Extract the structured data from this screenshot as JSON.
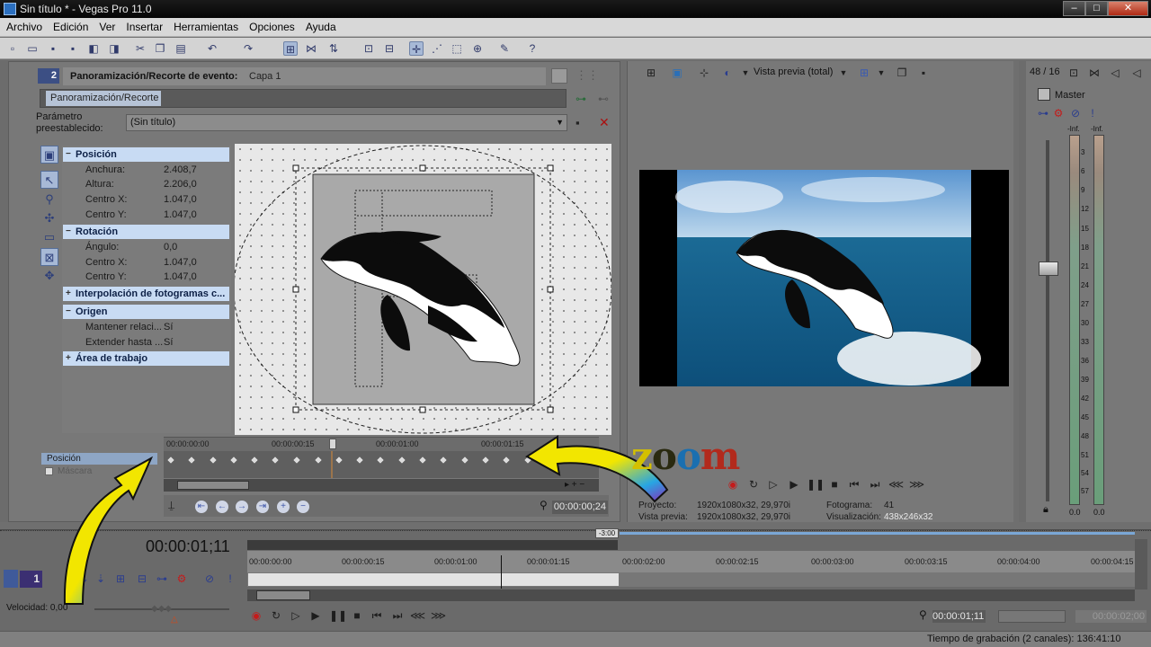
{
  "window": {
    "title": "Sin título * - Vegas Pro 11.0",
    "minimize": "–",
    "maximize": "□",
    "close": "✕"
  },
  "menu": [
    "Archivo",
    "Edición",
    "Ver",
    "Insertar",
    "Herramientas",
    "Opciones",
    "Ayuda"
  ],
  "pan_panel": {
    "chip": "2",
    "title": "Panoramización/Recorte de evento:",
    "subtitle": "Capa 1",
    "fx_tag": "Panoramización/Recorte",
    "preset_label": "Parámetro preestablecido:",
    "preset_value": "(Sin título)",
    "groups": {
      "position": {
        "label": "Posición",
        "rows": [
          {
            "key": "Anchura:",
            "value": "2.408,7"
          },
          {
            "key": "Altura:",
            "value": "2.206,0"
          },
          {
            "key": "Centro X:",
            "value": "1.047,0"
          },
          {
            "key": "Centro Y:",
            "value": "1.047,0"
          }
        ]
      },
      "rotation": {
        "label": "Rotación",
        "rows": [
          {
            "key": "Ángulo:",
            "value": "0,0"
          },
          {
            "key": "Centro X:",
            "value": "1.047,0"
          },
          {
            "key": "Centro Y:",
            "value": "1.047,0"
          }
        ]
      },
      "interp": {
        "label": "Interpolación de fotogramas c..."
      },
      "origin": {
        "label": "Origen",
        "rows": [
          {
            "key": "Mantener relaci...",
            "value": "Sí"
          },
          {
            "key": "Extender hasta ...",
            "value": "Sí"
          }
        ]
      },
      "workarea": {
        "label": "Área de trabajo"
      }
    },
    "timeline": {
      "labels": [
        "00:00:00:00",
        "00:00:00:15",
        "00:00:01:00",
        "00:00:01:15"
      ],
      "row_position": "Posición",
      "row_mask": "Máscara",
      "timecode": "00:00:00;24"
    }
  },
  "preview": {
    "label": "Vista previa (total)",
    "project_label": "Proyecto:",
    "project_value": "1920x1080x32, 29,970i",
    "preview_label": "Vista previa:",
    "preview_value": "1920x1080x32, 29,970i",
    "frame_label": "Fotograma:",
    "frame_value": "41",
    "display_label": "Visualización:",
    "display_value": "438x246x32"
  },
  "mixer": {
    "count": "48 / 16",
    "master": "Master",
    "inf_left": "-Inf.",
    "inf_right": "-Inf.",
    "ticks": [
      "3",
      "6",
      "9",
      "12",
      "15",
      "18",
      "21",
      "24",
      "27",
      "30",
      "33",
      "36",
      "39",
      "42",
      "45",
      "48",
      "51",
      "54",
      "57"
    ],
    "level_left": "0.0",
    "level_right": "0.0"
  },
  "timeline": {
    "timecode": "00:00:01;11",
    "marker": "-3:00",
    "ruler": [
      "00:00:00:00",
      "00:00:00:15",
      "00:00:01:00",
      "00:00:01:15",
      "00:00:02:00",
      "00:00:02:15",
      "00:00:03:00",
      "00:00:03:15",
      "00:00:04:00",
      "00:00:04:15"
    ],
    "track_number": "1",
    "speed": "Velocidad: 0,00",
    "current_time": "00:00:01;11",
    "end_time": "00:00:02;00",
    "status": "Tiempo de grabación (2 canales): 136:41:10"
  },
  "annotation": {
    "z1": "z",
    "z2": "o",
    "z3": "o",
    "z4": "m"
  },
  "colors": {
    "selected_property": "#c8dbf3",
    "accent_blue": "#3c4f84",
    "arrow_yellow": "#f2e600"
  }
}
